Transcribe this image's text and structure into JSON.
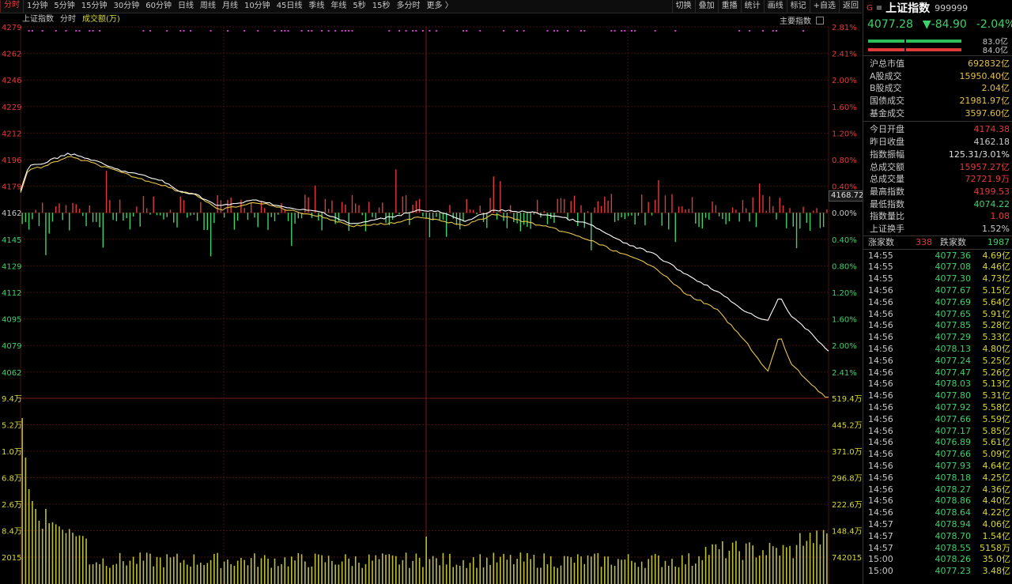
{
  "toolbar": {
    "periods": [
      "分时",
      "1分钟",
      "5分钟",
      "15分钟",
      "30分钟",
      "60分钟",
      "日线",
      "周线",
      "月线",
      "10分钟",
      "45日线",
      "季线",
      "年线",
      "5秒",
      "15秒",
      "多分时",
      "更多 〉"
    ],
    "active_period": 0,
    "right_buttons": [
      "切换",
      "叠加",
      "重播",
      "统计",
      "画线",
      "标记",
      "+自选",
      "返回"
    ]
  },
  "legend": {
    "index_name": "上证指数",
    "mode": "分时",
    "volume_label": "成交额(万)"
  },
  "main_index_label": "主要指数",
  "current_price_box": "4168.72",
  "axes": {
    "price_left": [
      "4279",
      "4262",
      "4246",
      "4229",
      "4212",
      "4196",
      "4179",
      "4162",
      "4145",
      "4129",
      "4112",
      "4095",
      "4079",
      "4062"
    ],
    "pct_right": [
      "2.81%",
      "2.41%",
      "2.00%",
      "1.60%",
      "1.20%",
      "0.80%",
      "0.40%",
      "0.00%",
      "0.40%",
      "0.80%",
      "1.20%",
      "1.60%",
      "2.00%",
      "2.41%"
    ],
    "vol_left": [
      "9.4万",
      "5.2万",
      "1.0万",
      "6.8万",
      "2.6万",
      "8.4万",
      "2015"
    ],
    "vol_right": [
      "519.4万",
      "445.2万",
      "371.0万",
      "296.8万",
      "222.6万",
      "148.4万",
      "742015"
    ]
  },
  "colors": {
    "up": "#e23a3a",
    "down": "#3fd16b",
    "grid": "#4a0f0f",
    "white_line": "#ffffff",
    "yellow_line": "#e8c74a",
    "vol": "#bfbf3a",
    "purple": "#d040d0"
  },
  "panel": {
    "g_label": "G",
    "eq_label": "≡",
    "title": "上证指数",
    "code": "999999",
    "price": "4077.28",
    "change": "▼-84.90",
    "change_pct": "-2.04%",
    "bar_up_value": "83.0亿",
    "bar_down_value": "84.0亿",
    "stats_group1": [
      {
        "label": "沪总市值",
        "value": "692832亿"
      },
      {
        "label": "A股成交",
        "value": "15950.40亿"
      },
      {
        "label": "B股成交",
        "value": "2.04亿"
      },
      {
        "label": "国债成交",
        "value": "21981.97亿"
      },
      {
        "label": "基金成交",
        "value": "3597.60亿"
      }
    ],
    "stats_group2": [
      {
        "label": "今日开盘",
        "value": "4174.38"
      },
      {
        "label": "昨日收盘",
        "value": "4162.18"
      },
      {
        "label": "指数振幅",
        "value": "125.31/3.01%"
      },
      {
        "label": "总成交额",
        "value": "15957.27亿"
      },
      {
        "label": "总成交量",
        "value": "72721.9万"
      },
      {
        "label": "最高指数",
        "value": "4199.53"
      },
      {
        "label": "最低指数",
        "value": "4074.22"
      },
      {
        "label": "指数量比",
        "value": "1.08"
      },
      {
        "label": "上证换手",
        "value": "1.52%"
      }
    ],
    "up_label": "涨家数",
    "up_count": "338",
    "down_label": "跌家数",
    "down_count": "1987",
    "ticks": [
      {
        "t": "14:55",
        "p": "4077.36",
        "v": "4.69亿"
      },
      {
        "t": "14:55",
        "p": "4077.08",
        "v": "4.46亿"
      },
      {
        "t": "14:55",
        "p": "4077.30",
        "v": "4.73亿"
      },
      {
        "t": "14:56",
        "p": "4077.67",
        "v": "5.15亿"
      },
      {
        "t": "14:56",
        "p": "4077.69",
        "v": "5.64亿"
      },
      {
        "t": "14:56",
        "p": "4077.65",
        "v": "5.91亿"
      },
      {
        "t": "14:56",
        "p": "4077.85",
        "v": "5.28亿"
      },
      {
        "t": "14:56",
        "p": "4077.29",
        "v": "5.33亿"
      },
      {
        "t": "14:56",
        "p": "4078.13",
        "v": "4.80亿"
      },
      {
        "t": "14:56",
        "p": "4077.24",
        "v": "5.25亿"
      },
      {
        "t": "14:56",
        "p": "4077.47",
        "v": "5.26亿"
      },
      {
        "t": "14:56",
        "p": "4078.03",
        "v": "5.13亿"
      },
      {
        "t": "14:56",
        "p": "4077.80",
        "v": "5.31亿"
      },
      {
        "t": "14:56",
        "p": "4077.92",
        "v": "5.58亿"
      },
      {
        "t": "14:56",
        "p": "4077.66",
        "v": "5.59亿"
      },
      {
        "t": "14:56",
        "p": "4077.17",
        "v": "5.85亿"
      },
      {
        "t": "14:56",
        "p": "4076.89",
        "v": "5.61亿"
      },
      {
        "t": "14:56",
        "p": "4077.66",
        "v": "5.09亿"
      },
      {
        "t": "14:56",
        "p": "4077.93",
        "v": "4.64亿"
      },
      {
        "t": "14:56",
        "p": "4078.18",
        "v": "4.25亿"
      },
      {
        "t": "14:56",
        "p": "4078.27",
        "v": "4.36亿"
      },
      {
        "t": "14:56",
        "p": "4078.86",
        "v": "4.40亿"
      },
      {
        "t": "14:56",
        "p": "4078.64",
        "v": "4.22亿"
      },
      {
        "t": "14:57",
        "p": "4078.94",
        "v": "4.06亿"
      },
      {
        "t": "14:57",
        "p": "4078.70",
        "v": "1.54亿"
      },
      {
        "t": "14:57",
        "p": "4078.55",
        "v": "5158万"
      },
      {
        "t": "15:00",
        "p": "4078.26",
        "v": "35.0亿"
      },
      {
        "t": "15:00",
        "p": "4077.23",
        "v": "3.48亿"
      }
    ]
  }
}
